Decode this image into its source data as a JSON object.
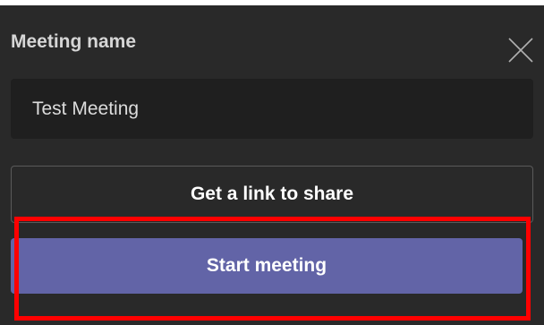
{
  "dialog": {
    "title": "Meeting name",
    "close_icon": "close-icon"
  },
  "meeting_name_input": {
    "value": "Test Meeting"
  },
  "buttons": {
    "get_link_label": "Get a link to share",
    "start_meeting_label": "Start meeting"
  },
  "colors": {
    "panel_background": "#292929",
    "input_background": "#1f1f1f",
    "primary_button": "#6264a7",
    "highlight_outline": "#ff0000"
  }
}
